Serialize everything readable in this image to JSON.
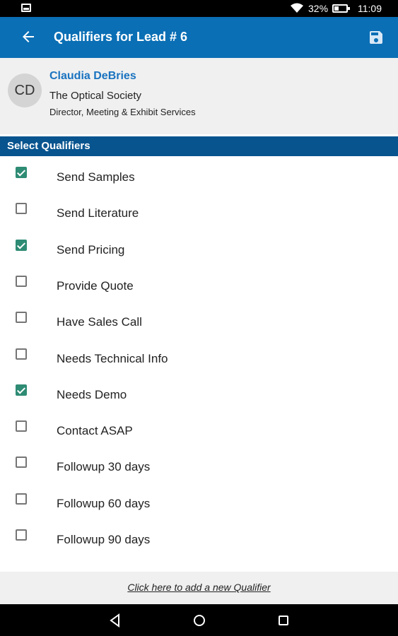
{
  "status_bar": {
    "battery_percent": "32%",
    "time": "11:09",
    "icons": [
      "notification-icon",
      "wifi-icon",
      "battery-icon"
    ]
  },
  "app_bar": {
    "title": "Qualifiers for Lead # 6",
    "back_icon": "back-arrow-icon",
    "save_icon": "save-icon",
    "color": "#0a6fb5"
  },
  "contact": {
    "initials": "CD",
    "name": "Claudia DeBries",
    "company": "The Optical Society",
    "title": "Director, Meeting & Exhibit Services"
  },
  "section": {
    "title": "Select Qualifiers",
    "color": "#07548f"
  },
  "qualifiers": [
    {
      "label": "Send Samples",
      "checked": true
    },
    {
      "label": "Send Literature",
      "checked": false
    },
    {
      "label": "Send Pricing",
      "checked": true
    },
    {
      "label": "Provide Quote",
      "checked": false
    },
    {
      "label": "Have Sales Call",
      "checked": false
    },
    {
      "label": "Needs Technical Info",
      "checked": false
    },
    {
      "label": "Needs Demo",
      "checked": true
    },
    {
      "label": "Contact ASAP",
      "checked": false
    },
    {
      "label": "Followup 30 days",
      "checked": false
    },
    {
      "label": "Followup 60 days",
      "checked": false
    },
    {
      "label": "Followup 90 days",
      "checked": false
    }
  ],
  "footer": {
    "add_link": "Click here to add a new Qualifier"
  },
  "nav_bar": {
    "buttons": [
      "back-triangle-icon",
      "home-circle-icon",
      "recents-square-icon"
    ]
  },
  "accent_color": "#2e8b74"
}
